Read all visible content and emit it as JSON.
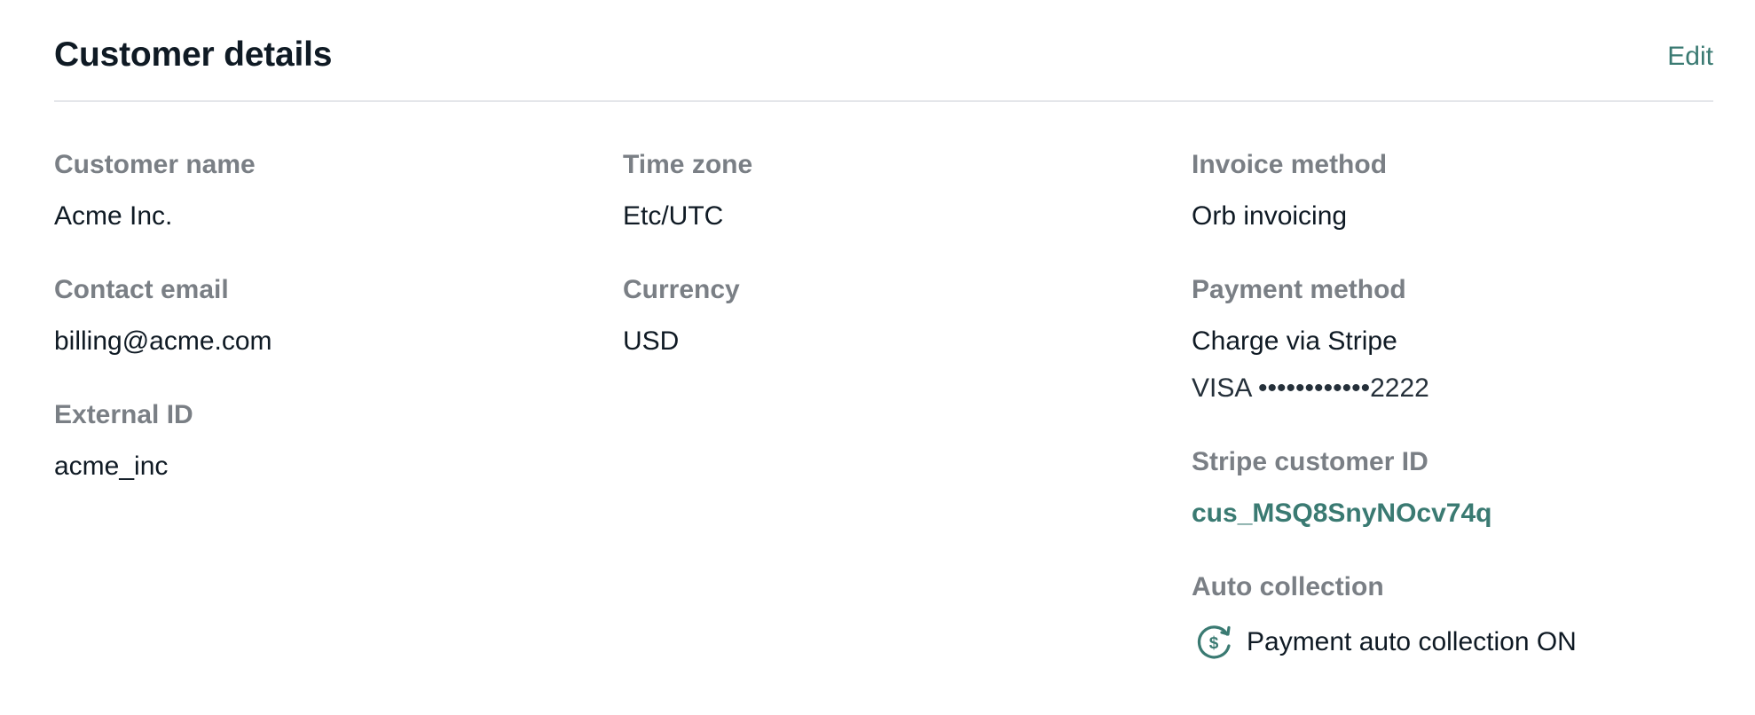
{
  "header": {
    "title": "Customer details",
    "edit_label": "Edit"
  },
  "fields": {
    "customer_name": {
      "label": "Customer name",
      "value": "Acme Inc."
    },
    "contact_email": {
      "label": "Contact email",
      "value": "billing@acme.com"
    },
    "external_id": {
      "label": "External ID",
      "value": "acme_inc"
    },
    "time_zone": {
      "label": "Time zone",
      "value": "Etc/UTC"
    },
    "currency": {
      "label": "Currency",
      "value": "USD"
    },
    "invoice_method": {
      "label": "Invoice method",
      "value": "Orb invoicing"
    },
    "payment_method": {
      "label": "Payment method",
      "value": "Charge via Stripe",
      "card": "VISA ••••••••••••2222"
    },
    "stripe_customer_id": {
      "label": "Stripe customer ID",
      "value": "cus_MSQ8SnyNOcv74q"
    },
    "auto_collection": {
      "label": "Auto collection",
      "value": "Payment auto collection ON",
      "icon": "dollar-refresh-icon"
    }
  },
  "colors": {
    "accent": "#3a7a72",
    "label": "#7a7f85",
    "text": "#0f1a24",
    "divider": "#e4e6ea"
  }
}
